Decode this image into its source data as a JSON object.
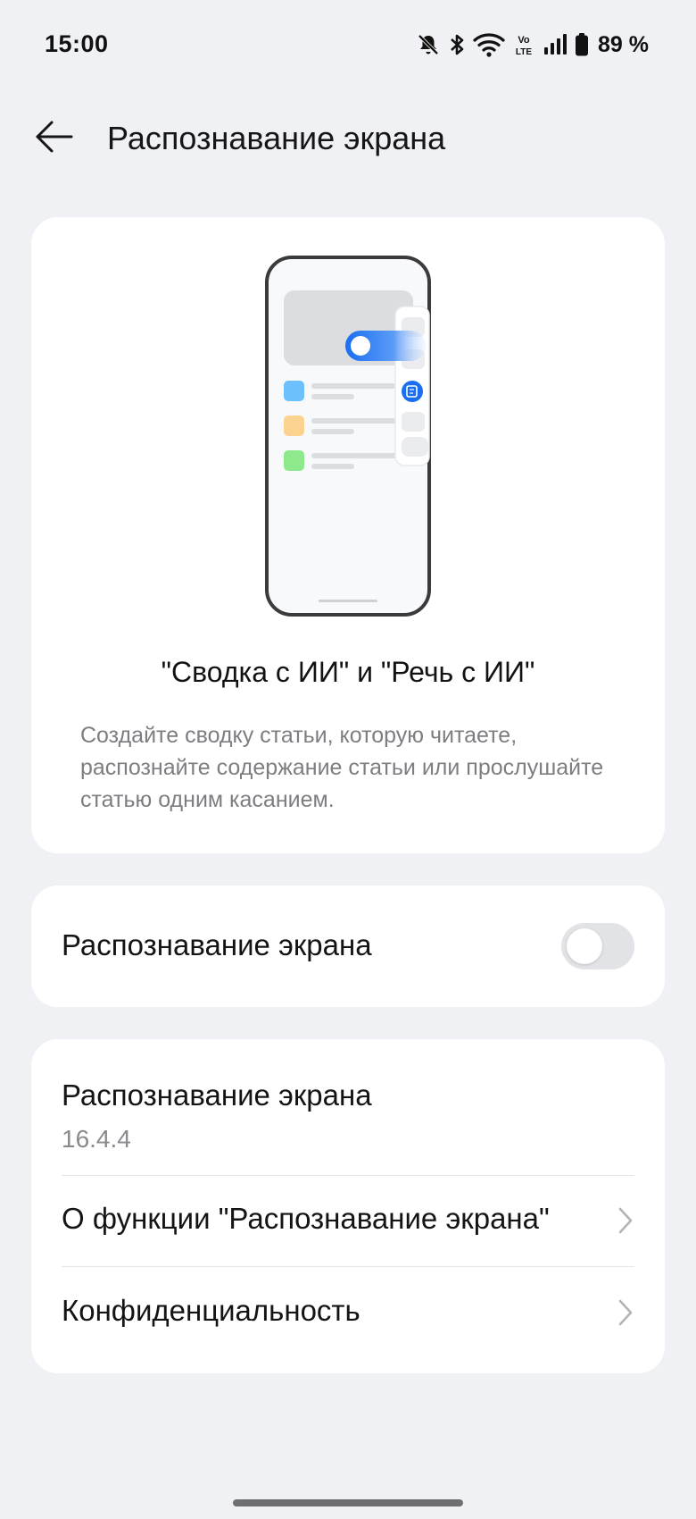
{
  "status_bar": {
    "time": "15:00",
    "battery": "89 %",
    "icons": [
      "bell-off-icon",
      "bluetooth-icon",
      "wifi-icon",
      "volte-icon",
      "signal-icon",
      "battery-icon"
    ]
  },
  "header": {
    "back_icon": "arrow-left-icon",
    "title": "Распознавание экрана"
  },
  "hero": {
    "illustration": "phone-screen-recognition-illustration",
    "title": "\"Сводка с ИИ\" и \"Речь с ИИ\"",
    "description": "Создайте сводку статьи, которую читаете, распознайте содержание статьи или прослушайте статью одним касанием."
  },
  "toggle": {
    "label": "Распознавание экрана",
    "enabled": false
  },
  "info": {
    "version_label": "Распознавание экрана",
    "version_value": "16.4.4",
    "about_label": "О функции \"Распознавание экрана\"",
    "privacy_label": "Конфиденциальность"
  },
  "colors": {
    "background": "#f0f1f4",
    "card": "#ffffff",
    "accent": "#1a6ef0",
    "toggle_off": "#e2e3e6",
    "secondary_text": "#7d7d82"
  }
}
